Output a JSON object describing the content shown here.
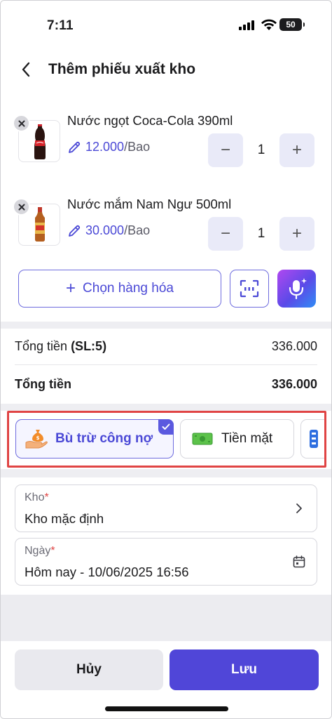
{
  "status_bar": {
    "time": "7:11",
    "battery": "50"
  },
  "header": {
    "title": "Thêm phiếu xuất kho"
  },
  "items": [
    {
      "name": "Nước ngọt Coca-Cola 390ml",
      "price": "12.000",
      "unit": "/Bao",
      "qty": "1",
      "minus": "−",
      "plus": "+"
    },
    {
      "name": "Nước mắm Nam Ngư 500ml",
      "price": "30.000",
      "unit": "/Bao",
      "qty": "1",
      "minus": "−",
      "plus": "+"
    }
  ],
  "actions": {
    "choose_label": "Chọn hàng hóa",
    "plus": "+"
  },
  "totals": {
    "row1_label": "Tổng tiền ",
    "row1_count": "(SL:5)",
    "row1_value": "336.000",
    "row2_label": "Tổng tiền",
    "row2_value": "336.000"
  },
  "payment_methods": [
    {
      "label": "Bù trừ công nợ",
      "selected": true
    },
    {
      "label": "Tiền mặt",
      "selected": false
    }
  ],
  "form": {
    "warehouse": {
      "label": "Kho",
      "required": "*",
      "value": "Kho mặc định"
    },
    "date": {
      "label": "Ngày",
      "required": "*",
      "value": "Hôm nay - 10/06/2025 16:56"
    }
  },
  "buttons": {
    "cancel": "Hủy",
    "save": "Lưu"
  },
  "colors": {
    "accent": "#5046d8",
    "highlight_border": "#e04444",
    "price": "#4b49d6"
  }
}
